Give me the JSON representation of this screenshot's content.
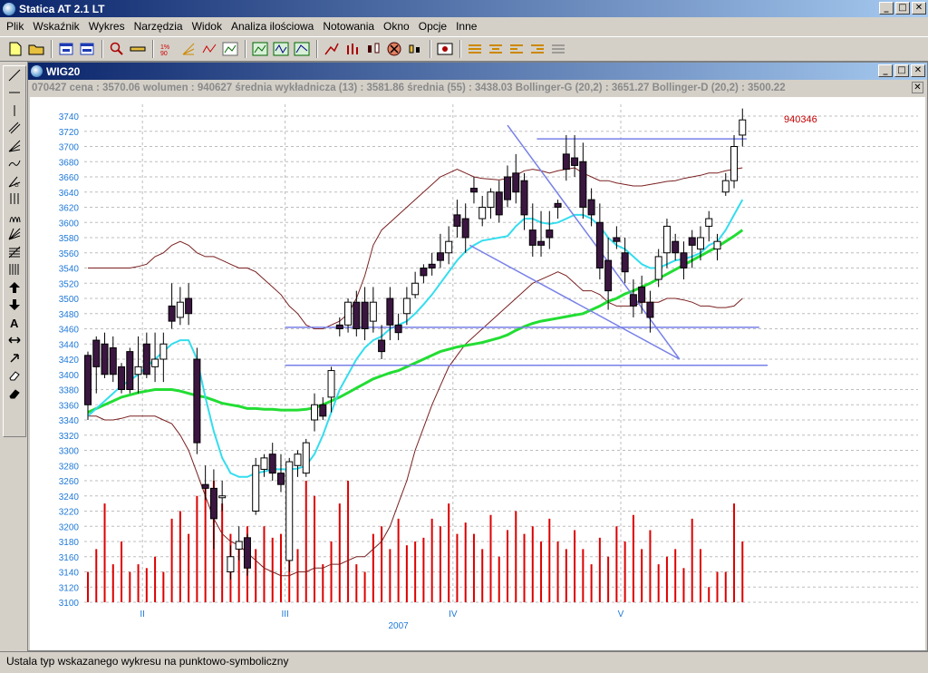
{
  "app": {
    "title": "Statica AT 2.1 LT"
  },
  "window_buttons": {
    "minimize": "_",
    "maximize": "□",
    "close": "✕"
  },
  "menu": [
    "Plik",
    "Wskaźnik",
    "Wykres",
    "Narzędzia",
    "Widok",
    "Analiza ilościowa",
    "Notowania",
    "Okno",
    "Opcje",
    "Inne"
  ],
  "toolbar_icons": [
    "new-file-icon",
    "open-folder-icon",
    "chart-window-icon",
    "chart-window-icon",
    "search-icon",
    "ruler-icon",
    "fibonacci-icon",
    "fan-icon",
    "zigzag-icon",
    "line-chart-icon",
    "line-chart-icon",
    "line-chart-icon",
    "line-tool-icon",
    "bar-chart-icon",
    "candlestick-icon",
    "cancel-icon",
    "candle-icon",
    "settings-icon",
    "align-icon",
    "align-icon",
    "align-icon",
    "align-icon",
    "align-icon"
  ],
  "left_tools": [
    "line-icon",
    "horizontal-line-icon",
    "vertical-line-icon",
    "parallel-lines-icon",
    "fan-lines-icon",
    "wave-icon",
    "speed-line-icon",
    "vertical-lines-icon",
    "cycles-icon",
    "gann-fan-icon",
    "fibonacci-retracement-icon",
    "vertical-grid-icon",
    "arrow-up-icon",
    "arrow-down-icon",
    "text-icon",
    "horizontal-arrows-icon",
    "move-icon",
    "eraser-icon",
    "eraser-all-icon"
  ],
  "chart_window": {
    "title": "WIG20",
    "info": "070427 cena : 3570.06 wolumen : 940627 średnia wykładnicza (13) : 3581.86 średnia (55) : 3438.03 Bollinger-G (20,2) : 3651.27 Bollinger-D (20,2) : 3500.22",
    "last_volume_label": "940346"
  },
  "status": "Ustala typ wskazanego wykresu na punktowo-symboliczny",
  "colors": {
    "up_candle": "#ffffff",
    "down_candle": "#3a1640",
    "volume": "#dd0000",
    "ema13": "#33ddee",
    "sma55": "#22dd33",
    "bollinger": "#7a2020",
    "trendline": "#7880e8",
    "axis_text": "#1e78d8"
  },
  "chart_data": {
    "type": "candlestick",
    "ylim": [
      3100,
      3750
    ],
    "yticks": [
      3740,
      3720,
      3700,
      3680,
      3660,
      3640,
      3620,
      3600,
      3580,
      3560,
      3540,
      3520,
      3500,
      3480,
      3460,
      3440,
      3420,
      3400,
      3380,
      3360,
      3340,
      3320,
      3300,
      3280,
      3260,
      3240,
      3220,
      3200,
      3180,
      3160,
      3140,
      3120,
      3100
    ],
    "xlabels": [
      {
        "index": 6,
        "label": "II"
      },
      {
        "index": 23,
        "label": "III"
      },
      {
        "index": 43,
        "label": "IV"
      },
      {
        "index": 63,
        "label": "V"
      }
    ],
    "year_label": {
      "index": 37,
      "label": "2007"
    },
    "candles": [
      [
        3370,
        3410,
        3350,
        3345
      ],
      [
        3410,
        3430,
        3385,
        3380
      ],
      [
        3445,
        3450,
        3415,
        3405
      ],
      [
        3440,
        3445,
        3405,
        3395
      ],
      [
        3395,
        3410,
        3385,
        3380
      ],
      [
        3415,
        3430,
        3395,
        3380
      ],
      [
        3400,
        3445,
        3390,
        3380
      ],
      [
        3445,
        3450,
        3405,
        3400
      ],
      [
        3395,
        3440,
        3450,
        3420
      ],
      [
        3410,
        3440,
        3450,
        3395
      ],
      [
        3480,
        3515,
        3500,
        3465
      ],
      [
        3470,
        3495,
        3510,
        3470
      ],
      [
        3510,
        3515,
        3475,
        3470
      ],
      [
        3420,
        3430,
        3315,
        3300
      ],
      [
        3265,
        3275,
        3250,
        3240
      ],
      [
        3258,
        3270,
        3200,
        3175
      ],
      [
        3245,
        3255,
        3230,
        3225
      ],
      [
        3140,
        3170,
        3140,
        3135
      ],
      [
        3190,
        3195,
        3175,
        3160
      ],
      [
        3185,
        3180,
        3145,
        3140
      ],
      [
        3275,
        3285,
        3245,
        3220
      ],
      [
        3275,
        3285,
        3290,
        3270
      ],
      [
        3295,
        3305,
        3270,
        3265
      ],
      [
        3270,
        3290,
        3250,
        3250
      ],
      [
        3150,
        3255,
        3285,
        3145
      ],
      [
        3280,
        3280,
        3295,
        3270
      ],
      [
        3305,
        3310,
        3280,
        3270
      ],
      [
        3340,
        3370,
        3370,
        3330
      ],
      [
        3345,
        3365,
        3360,
        3350
      ],
      [
        3365,
        3405,
        3390,
        3355
      ],
      [
        3465,
        3470,
        3460,
        3455
      ],
      [
        3475,
        3485,
        3495,
        3460
      ],
      [
        3495,
        3505,
        3460,
        3455
      ],
      [
        3495,
        3510,
        3460,
        3450
      ],
      [
        3470,
        3510,
        3490,
        3460
      ],
      [
        3445,
        3460,
        3430,
        3425
      ],
      [
        3500,
        3510,
        3465,
        3450
      ],
      [
        3465,
        3475,
        3455,
        3450
      ],
      [
        3500,
        3510,
        3480,
        3470
      ],
      [
        3510,
        3530,
        3530,
        3505
      ],
      [
        3540,
        3540,
        3530,
        3525
      ],
      [
        3545,
        3555,
        3540,
        3535
      ],
      [
        3560,
        3580,
        3550,
        3545
      ],
      [
        3560,
        3575,
        3590,
        3550
      ],
      [
        3610,
        3625,
        3595,
        3585
      ],
      [
        3600,
        3620,
        3575,
        3565
      ],
      [
        3645,
        3655,
        3640,
        3630
      ],
      [
        3600,
        3630,
        3620,
        3600
      ],
      [
        3620,
        3630,
        3640,
        3610
      ],
      [
        3640,
        3650,
        3610,
        3605
      ],
      [
        3660,
        3670,
        3630,
        3625
      ],
      [
        3665,
        3685,
        3640,
        3630
      ],
      [
        3650,
        3660,
        3610,
        3595
      ],
      [
        3590,
        3620,
        3565,
        3560
      ],
      [
        3575,
        3610,
        3570,
        3560
      ],
      [
        3590,
        3610,
        3580,
        3570
      ],
      [
        3620,
        3625,
        3620,
        3610
      ],
      [
        3690,
        3710,
        3670,
        3660
      ],
      [
        3685,
        3710,
        3680,
        3665
      ],
      [
        3690,
        3700,
        3615,
        3610
      ],
      [
        3630,
        3640,
        3610,
        3600
      ],
      [
        3600,
        3620,
        3540,
        3530
      ],
      [
        3550,
        3575,
        3510,
        3490
      ],
      [
        3580,
        3590,
        3575,
        3570
      ],
      [
        3560,
        3575,
        3535,
        3525
      ],
      [
        3505,
        3520,
        3485,
        3480
      ],
      [
        3515,
        3525,
        3495,
        3485
      ],
      [
        3495,
        3505,
        3470,
        3460
      ],
      [
        3520,
        3530,
        3560,
        3520
      ],
      [
        3560,
        3580,
        3600,
        3545
      ],
      [
        3560,
        3575,
        3580,
        3555
      ],
      [
        3535,
        3570,
        3565,
        3530
      ],
      [
        3580,
        3585,
        3570,
        3545
      ],
      [
        3565,
        3590,
        3585,
        3555
      ],
      [
        3595,
        3610,
        3610,
        3580
      ],
      [
        3575,
        3570,
        3580,
        3555
      ],
      [
        3655,
        3660,
        3640,
        3640
      ],
      [
        3675,
        3700,
        3710,
        3650
      ],
      [
        3710,
        3745,
        3735,
        3705
      ]
    ],
    "candle_open_close": [
      [
        3425,
        3360
      ],
      [
        3445,
        3410
      ],
      [
        3440,
        3400
      ],
      [
        3435,
        3400
      ],
      [
        3410,
        3380
      ],
      [
        3430,
        3380
      ],
      [
        3400,
        3410
      ],
      [
        3440,
        3400
      ],
      [
        3410,
        3420
      ],
      [
        3420,
        3440
      ],
      [
        3490,
        3470
      ],
      [
        3475,
        3495
      ],
      [
        3500,
        3480
      ],
      [
        3420,
        3310
      ],
      [
        3255,
        3250
      ],
      [
        3250,
        3210
      ],
      [
        3240,
        3240
      ],
      [
        3140,
        3160
      ],
      [
        3170,
        3180
      ],
      [
        3185,
        3145
      ],
      [
        3220,
        3280
      ],
      [
        3275,
        3290
      ],
      [
        3295,
        3270
      ],
      [
        3270,
        3255
      ],
      [
        3155,
        3285
      ],
      [
        3280,
        3295
      ],
      [
        3270,
        3310
      ],
      [
        3340,
        3360
      ],
      [
        3360,
        3345
      ],
      [
        3370,
        3405
      ],
      [
        3465,
        3460
      ],
      [
        3465,
        3495
      ],
      [
        3495,
        3460
      ],
      [
        3495,
        3460
      ],
      [
        3470,
        3495
      ],
      [
        3445,
        3430
      ],
      [
        3500,
        3465
      ],
      [
        3465,
        3455
      ],
      [
        3480,
        3500
      ],
      [
        3505,
        3520
      ],
      [
        3540,
        3530
      ],
      [
        3545,
        3540
      ],
      [
        3560,
        3550
      ],
      [
        3560,
        3575
      ],
      [
        3610,
        3595
      ],
      [
        3605,
        3580
      ],
      [
        3645,
        3640
      ],
      [
        3605,
        3620
      ],
      [
        3620,
        3640
      ],
      [
        3640,
        3610
      ],
      [
        3660,
        3630
      ],
      [
        3665,
        3640
      ],
      [
        3655,
        3610
      ],
      [
        3590,
        3570
      ],
      [
        3575,
        3570
      ],
      [
        3590,
        3580
      ],
      [
        3625,
        3620
      ],
      [
        3690,
        3670
      ],
      [
        3685,
        3675
      ],
      [
        3680,
        3620
      ],
      [
        3630,
        3610
      ],
      [
        3600,
        3540
      ],
      [
        3550,
        3510
      ],
      [
        3580,
        3575
      ],
      [
        3560,
        3535
      ],
      [
        3505,
        3490
      ],
      [
        3515,
        3495
      ],
      [
        3495,
        3475
      ],
      [
        3525,
        3555
      ],
      [
        3560,
        3595
      ],
      [
        3575,
        3560
      ],
      [
        3560,
        3540
      ],
      [
        3580,
        3570
      ],
      [
        3565,
        3580
      ],
      [
        3595,
        3605
      ],
      [
        3565,
        3575
      ],
      [
        3640,
        3655
      ],
      [
        3655,
        3700
      ],
      [
        3715,
        3735
      ]
    ],
    "volume": [
      3140,
      3170,
      3230,
      3150,
      3180,
      3140,
      3150,
      3145,
      3160,
      3140,
      3210,
      3220,
      3190,
      3240,
      3250,
      3260,
      3230,
      3190,
      3180,
      3200,
      3170,
      3200,
      3185,
      3190,
      3160,
      3170,
      3260,
      3240,
      3150,
      3180,
      3230,
      3270,
      3150,
      3140,
      3190,
      3200,
      3170,
      3210,
      3175,
      3180,
      3185,
      3210,
      3200,
      3230,
      3190,
      3205,
      3190,
      3170,
      3215,
      3160,
      3195,
      3220,
      3190,
      3200,
      3180,
      3210,
      3180,
      3170,
      3195,
      3170,
      3150,
      3185,
      3160,
      3200,
      3180,
      3215,
      3170,
      3195,
      3150,
      3160,
      3170,
      3145,
      3210,
      3170,
      3120,
      3140,
      3140,
      3230,
      3180
    ],
    "ema13": [
      3345,
      3355,
      3365,
      3375,
      3385,
      3392,
      3400,
      3410,
      3420,
      3430,
      3440,
      3445,
      3445,
      3420,
      3370,
      3325,
      3290,
      3270,
      3265,
      3265,
      3270,
      3272,
      3275,
      3275,
      3275,
      3276,
      3280,
      3295,
      3320,
      3350,
      3380,
      3400,
      3420,
      3435,
      3445,
      3450,
      3460,
      3465,
      3470,
      3480,
      3492,
      3505,
      3520,
      3535,
      3550,
      3562,
      3570,
      3576,
      3578,
      3580,
      3582,
      3595,
      3605,
      3605,
      3600,
      3598,
      3600,
      3605,
      3610,
      3610,
      3605,
      3595,
      3580,
      3570,
      3565,
      3555,
      3545,
      3540,
      3540,
      3545,
      3550,
      3552,
      3555,
      3560,
      3570,
      3575,
      3590,
      3610,
      3630
    ],
    "sma55": [
      3350,
      3355,
      3360,
      3365,
      3370,
      3373,
      3376,
      3378,
      3380,
      3380,
      3380,
      3378,
      3375,
      3372,
      3370,
      3366,
      3362,
      3360,
      3358,
      3355,
      3355,
      3354,
      3354,
      3353,
      3353,
      3353,
      3354,
      3356,
      3360,
      3365,
      3370,
      3376,
      3382,
      3388,
      3394,
      3398,
      3402,
      3405,
      3410,
      3415,
      3420,
      3425,
      3430,
      3433,
      3436,
      3438,
      3440,
      3442,
      3445,
      3448,
      3452,
      3458,
      3463,
      3467,
      3470,
      3472,
      3474,
      3476,
      3478,
      3480,
      3485,
      3490,
      3496,
      3500,
      3506,
      3510,
      3515,
      3520,
      3526,
      3532,
      3538,
      3544,
      3550,
      3556,
      3562,
      3568,
      3575,
      3582,
      3590
    ],
    "boll_upper": [
      3540,
      3540,
      3540,
      3540,
      3540,
      3540,
      3542,
      3545,
      3555,
      3560,
      3570,
      3575,
      3570,
      3560,
      3555,
      3555,
      3550,
      3545,
      3540,
      3540,
      3535,
      3525,
      3515,
      3505,
      3490,
      3480,
      3465,
      3460,
      3460,
      3465,
      3470,
      3480,
      3500,
      3530,
      3570,
      3590,
      3600,
      3610,
      3620,
      3630,
      3640,
      3650,
      3660,
      3665,
      3670,
      3665,
      3660,
      3658,
      3657,
      3656,
      3658,
      3662,
      3668,
      3670,
      3668,
      3665,
      3668,
      3670,
      3672,
      3665,
      3660,
      3655,
      3655,
      3652,
      3650,
      3648,
      3648,
      3650,
      3652,
      3654,
      3655,
      3658,
      3660,
      3662,
      3665,
      3665,
      3668,
      3670,
      3672
    ],
    "boll_lower": [
      3345,
      3345,
      3340,
      3340,
      3342,
      3345,
      3345,
      3345,
      3345,
      3340,
      3335,
      3320,
      3300,
      3270,
      3240,
      3210,
      3190,
      3180,
      3175,
      3165,
      3155,
      3145,
      3140,
      3135,
      3135,
      3140,
      3140,
      3145,
      3145,
      3150,
      3150,
      3155,
      3160,
      3160,
      3170,
      3180,
      3200,
      3230,
      3260,
      3300,
      3330,
      3360,
      3385,
      3410,
      3425,
      3440,
      3450,
      3460,
      3470,
      3480,
      3490,
      3500,
      3510,
      3520,
      3525,
      3530,
      3535,
      3530,
      3520,
      3510,
      3510,
      3505,
      3495,
      3490,
      3490,
      3490,
      3495,
      3495,
      3495,
      3500,
      3500,
      3498,
      3495,
      3490,
      3490,
      3488,
      3488,
      3490,
      3500
    ],
    "trendlines": [
      {
        "x1": 53.5,
        "y1": 3710,
        "x2": 78.5,
        "y2": 3710
      },
      {
        "x1": 23.5,
        "y1": 3462,
        "x2": 80,
        "y2": 3462
      },
      {
        "x1": 23.5,
        "y1": 3412,
        "x2": 81,
        "y2": 3412
      },
      {
        "x1": 50,
        "y1": 3728,
        "x2": 70.5,
        "y2": 3420
      },
      {
        "x1": 45.5,
        "y1": 3570,
        "x2": 70.5,
        "y2": 3420
      }
    ]
  }
}
